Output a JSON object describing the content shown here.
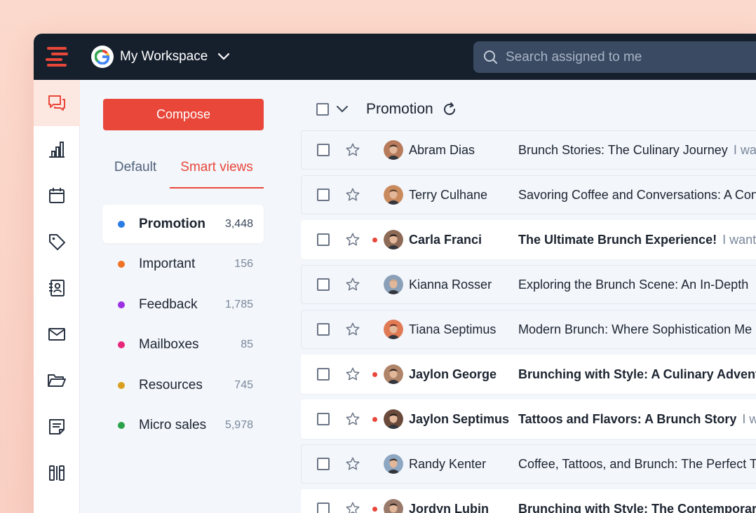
{
  "brand": {
    "accent": "#e9473a",
    "topbar_bg": "#16202d"
  },
  "workspace": {
    "name": "My Workspace",
    "icon": "google-g-icon"
  },
  "search": {
    "placeholder": "Search assigned to me"
  },
  "rail": [
    {
      "icon": "conversations-icon",
      "active": true
    },
    {
      "icon": "bar-chart-icon"
    },
    {
      "icon": "calendar-icon"
    },
    {
      "icon": "tag-icon"
    },
    {
      "icon": "contacts-icon"
    },
    {
      "icon": "mail-icon"
    },
    {
      "icon": "folder-icon"
    },
    {
      "icon": "notes-icon"
    },
    {
      "icon": "tools-icon"
    }
  ],
  "compose": {
    "label": "Compose"
  },
  "tabs": {
    "default": "Default",
    "smart": "Smart views"
  },
  "views": [
    {
      "label": "Promotion",
      "count": "3,448",
      "color": "#2b7be5",
      "active": true
    },
    {
      "label": "Important",
      "count": "156",
      "color": "#f07223"
    },
    {
      "label": "Feedback",
      "count": "1,785",
      "color": "#9b30e3"
    },
    {
      "label": "Mailboxes",
      "count": "85",
      "color": "#e6277a"
    },
    {
      "label": "Resources",
      "count": "745",
      "color": "#d9a020"
    },
    {
      "label": "Micro sales",
      "count": "5,978",
      "color": "#2aa24a"
    }
  ],
  "list": {
    "title": "Promotion",
    "rows": [
      {
        "sender": "Abram Dias",
        "subject": "Brunch Stories: The Culinary Journey",
        "snippet": "I wa",
        "unread": false,
        "avatar_bg": "#b77a5a",
        "hair": "#3a2a22"
      },
      {
        "sender": "Terry Culhane",
        "subject": "Savoring Coffee and Conversations: A Con",
        "snippet": "",
        "unread": false,
        "avatar_bg": "#c98a5e",
        "hair": "#5a3d2a"
      },
      {
        "sender": "Carla Franci",
        "subject": "The Ultimate Brunch Experience!",
        "snippet": "I wante",
        "unread": true,
        "avatar_bg": "#8d6a55",
        "hair": "#1f1a18"
      },
      {
        "sender": "Kianna Rosser",
        "subject": "Exploring the Brunch Scene: An In-Depth",
        "snippet": "",
        "unread": false,
        "avatar_bg": "#8aa0b8",
        "hair": "#c9a58a"
      },
      {
        "sender": "Tiana Septimus",
        "subject": "Modern Brunch: Where Sophistication Me",
        "snippet": "",
        "unread": false,
        "avatar_bg": "#e07a55",
        "hair": "#6b2a1a"
      },
      {
        "sender": "Jaylon George",
        "subject": "Brunching with Style: A Culinary Adventu",
        "snippet": "",
        "unread": true,
        "avatar_bg": "#b08468",
        "hair": "#2a1f1a"
      },
      {
        "sender": "Jaylon Septimus",
        "subject": "Tattoos and Flavors: A Brunch Story",
        "snippet": "I wa",
        "unread": true,
        "avatar_bg": "#6a4a3a",
        "hair": "#1a1412"
      },
      {
        "sender": "Randy Kenter",
        "subject": "Coffee, Tattoos, and Brunch: The Perfect T",
        "snippet": "",
        "unread": false,
        "avatar_bg": "#8da6c2",
        "hair": "#3a2d25"
      },
      {
        "sender": "Jordyn Lubin",
        "subject": "Brunching with Style: The Contemporary",
        "snippet": "",
        "unread": true,
        "avatar_bg": "#9a7a6a",
        "hair": "#2a201c"
      }
    ]
  }
}
